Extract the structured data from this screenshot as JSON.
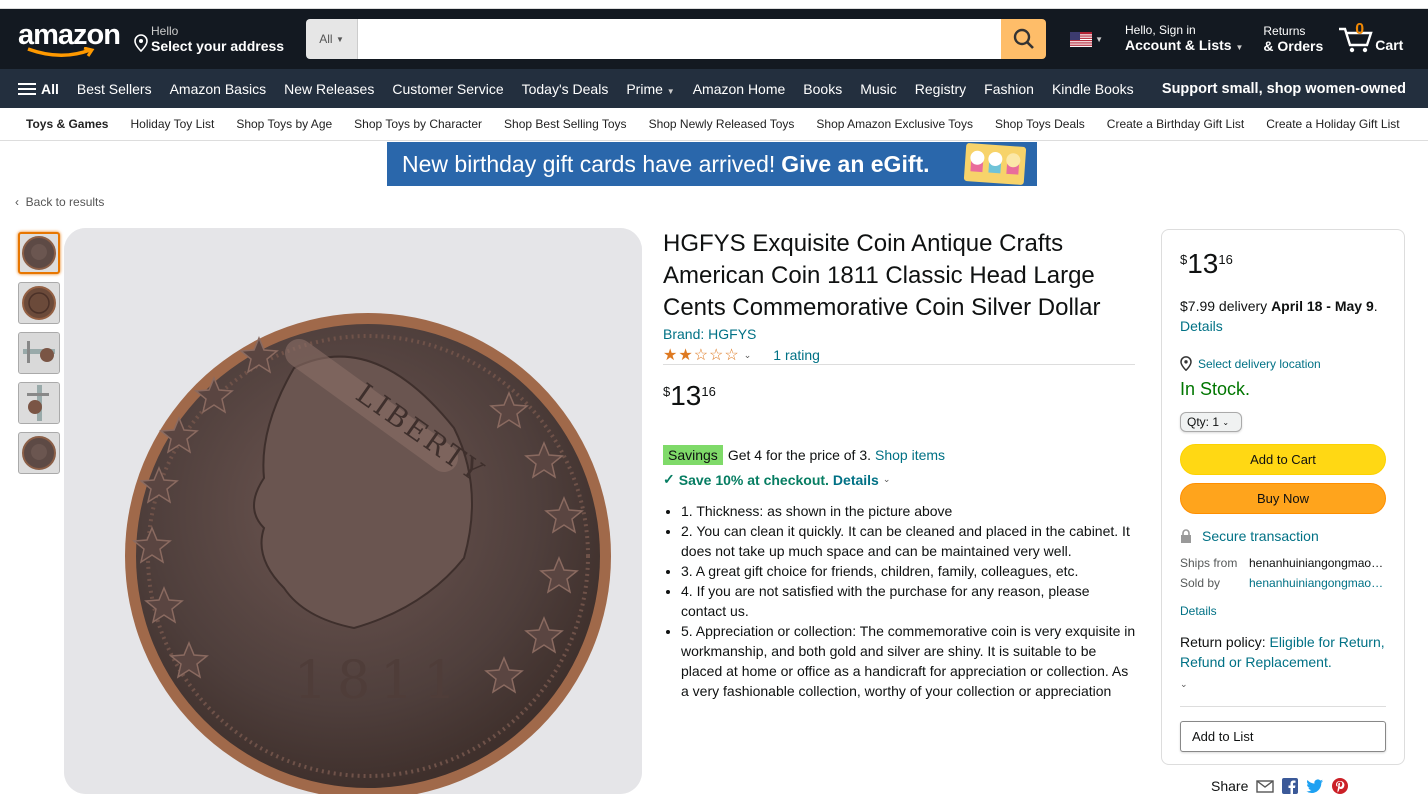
{
  "header": {
    "logo": "amazon",
    "address_small": "Hello",
    "address_bold": "Select your address",
    "search_category": "All",
    "search_placeholder": "",
    "account_small": "Hello, Sign in",
    "account_bold": "Account & Lists",
    "returns_small": "Returns",
    "returns_bold": "& Orders",
    "cart_count": "0",
    "cart_label": "Cart"
  },
  "nav": {
    "all_label": "All",
    "items": [
      "Best Sellers",
      "Amazon Basics",
      "New Releases",
      "Customer Service",
      "Today's Deals",
      "Prime",
      "Amazon Home",
      "Books",
      "Music",
      "Registry",
      "Fashion",
      "Kindle Books"
    ],
    "promo": "Support small, shop women-owned"
  },
  "subnav": [
    "Toys & Games",
    "Holiday Toy List",
    "Shop Toys by Age",
    "Shop Toys by Character",
    "Shop Best Selling Toys",
    "Shop Newly Released Toys",
    "Shop Amazon Exclusive Toys",
    "Shop Toys Deals",
    "Create a Birthday Gift List",
    "Create a Holiday Gift List"
  ],
  "banner": {
    "text": "New birthday gift cards have arrived!",
    "cta": "Give an eGift."
  },
  "back_link": "Back to results",
  "product": {
    "title": "HGFYS Exquisite Coin Antique Crafts American Coin 1811 Classic Head Large Cents Commemorative Coin Silver Dollar",
    "brand": "Brand: HGFYS",
    "stars": 2.5,
    "rating_text": "1 rating",
    "price_symbol": "$",
    "price_whole": "13",
    "price_fraction": "16",
    "savings_badge": "Savings",
    "savings_text": "Get 4 for the price of 3.",
    "savings_link": "Shop items",
    "coupon_text": "Save 10% at checkout.",
    "coupon_link": "Details",
    "bullets": [
      "1. Thickness: as shown in the picture above",
      "2. You can clean it quickly. It can be cleaned and placed in the cabinet. It does not take up much space and can be maintained very well.",
      "3. A great gift choice for friends, children, family, colleagues, etc.",
      "4. If you are not satisfied with the purchase for any reason, please contact us.",
      "5. Appreciation or collection: The commemorative coin is very exquisite in workmanship, and both gold and silver are shiny. It is suitable to be placed at home or office as a handicraft for appreciation or collection. As a very fashionable collection, worthy of your collection or appreciation"
    ],
    "coin_text": {
      "top": "LIBERTY",
      "year": "1811"
    }
  },
  "buybox": {
    "price_symbol": "$",
    "price_whole": "13",
    "price_fraction": "16",
    "delivery_prefix": "$7.99 delivery",
    "delivery_dates": "April 18 - May 9",
    "delivery_link": "Details",
    "location": "Select delivery location",
    "stock": "In Stock.",
    "qty": "Qty: 1",
    "add_to_cart": "Add to Cart",
    "buy_now": "Buy Now",
    "secure": "Secure transaction",
    "ships_from_label": "Ships from",
    "ships_from": "henanhuiniangongmaoyouxiangongsi",
    "sold_by_label": "Sold by",
    "sold_by": "henanhuiniangongmaoyouxiangongsi",
    "details": "Details",
    "return_label": "Return policy:",
    "return_link": "Eligible for Return, Refund or Replacement.",
    "add_to_list": "Add to List"
  },
  "share_label": "Share",
  "colors": {
    "nav_dark": "#131921",
    "nav_mid": "#232f3e",
    "link": "#007185",
    "star": "#de7921",
    "cart_btn": "#ffd814",
    "buy_btn": "#ffa41c",
    "stock_green": "#007600"
  }
}
